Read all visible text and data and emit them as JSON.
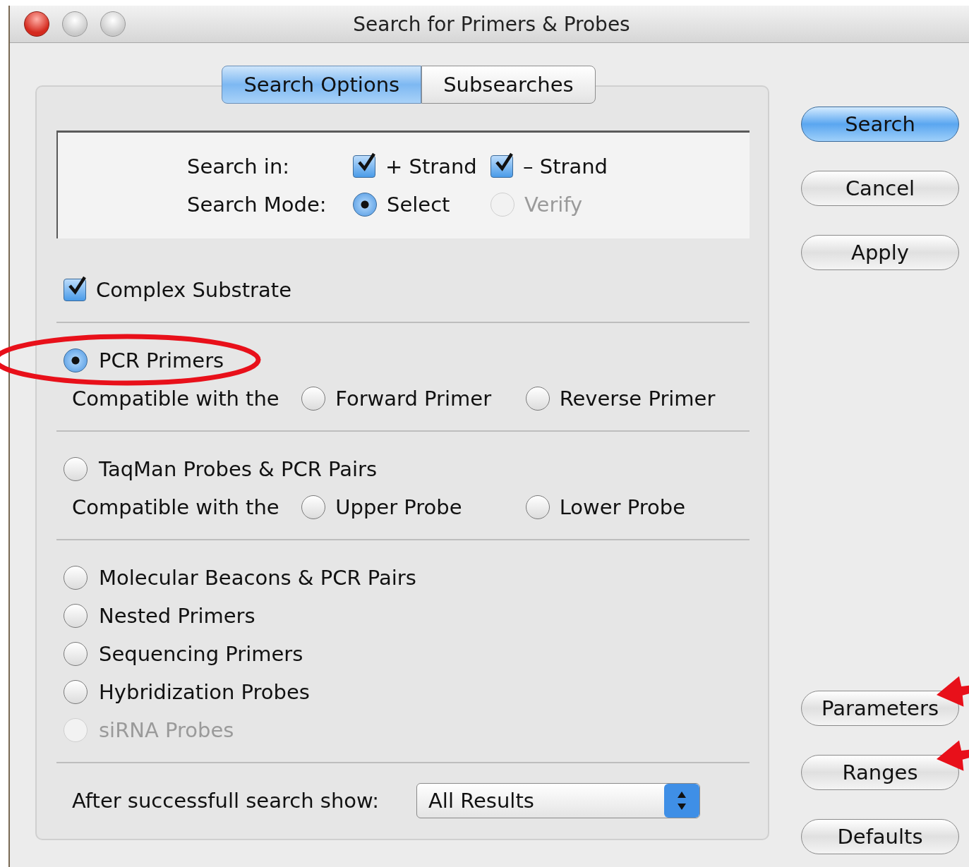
{
  "window": {
    "title": "Search for Primers & Probes"
  },
  "tabs": [
    {
      "label": "Search Options",
      "selected": true
    },
    {
      "label": "Subsearches",
      "selected": false
    }
  ],
  "search_in": {
    "label": "Search in:",
    "options": [
      {
        "label": "+ Strand",
        "checked": true
      },
      {
        "label": "– Strand",
        "checked": true
      }
    ]
  },
  "search_mode": {
    "label": "Search Mode:",
    "options": [
      {
        "label": "Select",
        "selected": true,
        "disabled": false
      },
      {
        "label": "Verify",
        "selected": false,
        "disabled": true
      }
    ]
  },
  "complex_substrate": {
    "label": "Complex Substrate",
    "checked": true
  },
  "groups": [
    [
      {
        "label": "PCR Primers",
        "selected": true,
        "disabled": false,
        "circled": true,
        "compat": {
          "label": "Compatible with the",
          "options": [
            {
              "label": "Forward Primer",
              "selected": false
            },
            {
              "label": "Reverse Primer",
              "selected": false
            }
          ]
        }
      }
    ],
    [
      {
        "label": "TaqMan Probes & PCR Pairs",
        "selected": false,
        "disabled": false,
        "compat": {
          "label": "Compatible with the",
          "options": [
            {
              "label": "Upper Probe",
              "selected": false
            },
            {
              "label": "Lower Probe",
              "selected": false
            }
          ]
        }
      }
    ],
    [
      {
        "label": "Molecular Beacons & PCR Pairs",
        "selected": false,
        "disabled": false
      },
      {
        "label": "Nested Primers",
        "selected": false,
        "disabled": false
      },
      {
        "label": "Sequencing Primers",
        "selected": false,
        "disabled": false
      },
      {
        "label": "Hybridization Probes",
        "selected": false,
        "disabled": false
      },
      {
        "label": "siRNA Probes",
        "selected": false,
        "disabled": true
      }
    ]
  ],
  "after": {
    "label": "After successfull search show:",
    "value": "All Results"
  },
  "buttons": [
    {
      "label": "Search",
      "default": true
    },
    {
      "label": "Cancel",
      "default": false
    },
    {
      "label": "Apply",
      "default": false
    }
  ],
  "lower_buttons": [
    {
      "label": "Parameters",
      "arrow": true
    },
    {
      "label": "Ranges",
      "arrow": true
    },
    {
      "label": "Defaults",
      "arrow": false
    }
  ]
}
